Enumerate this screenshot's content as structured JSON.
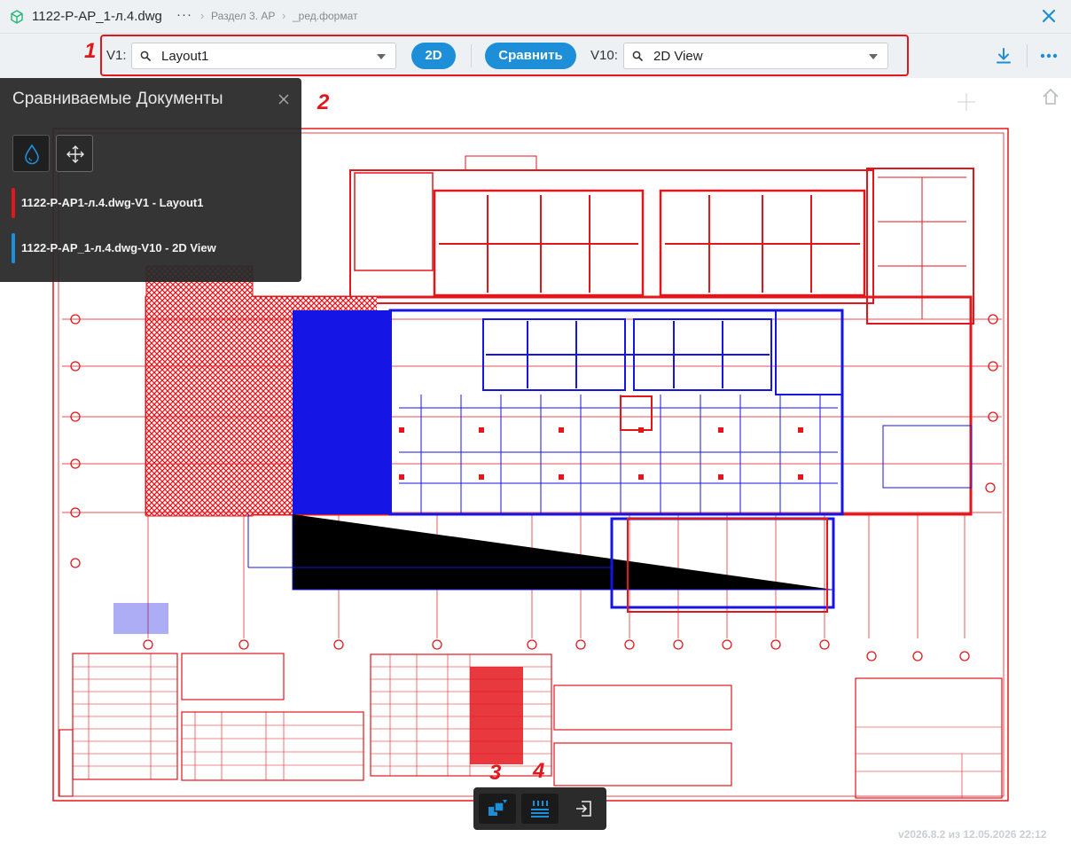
{
  "titlebar": {
    "file_name": "1122-Р-АР_1-л.4.dwg",
    "more": "···",
    "breadcrumb_sep": "›",
    "breadcrumb_1": "Раздел 3. АР",
    "breadcrumb_2": "_ред.формат"
  },
  "toolbar": {
    "v1_label": "V1:",
    "v1_value": "Layout1",
    "mode_label": "2D",
    "compare_label": "Сравнить",
    "v10_label": "V10:",
    "v10_value": "2D View"
  },
  "markers": {
    "m1": "1",
    "m2": "2",
    "m3": "3",
    "m4": "4"
  },
  "panel": {
    "title": "Сравниваемые Документы",
    "documents": [
      {
        "label": "1122-Р-АР1-л.4.dwg-V1 - Layout1",
        "color": "#e3161c"
      },
      {
        "label": "1122-Р-АР_1-л.4.dwg-V10 - 2D View",
        "color": "#1d8ed8"
      }
    ]
  },
  "colors": {
    "accent": "#1d8ed8",
    "v1_color": "#e3161c",
    "v10_color": "#1515e6",
    "frame": "#e3161c"
  },
  "icons": [
    "cube-icon",
    "close-icon",
    "search-icon",
    "download-icon",
    "more-icon",
    "drop-icon",
    "move-icon",
    "overlay-icon",
    "list-icon",
    "exit-icon",
    "home-icon"
  ],
  "version": "v2026.8.2 из 12.05.2026 22:12"
}
